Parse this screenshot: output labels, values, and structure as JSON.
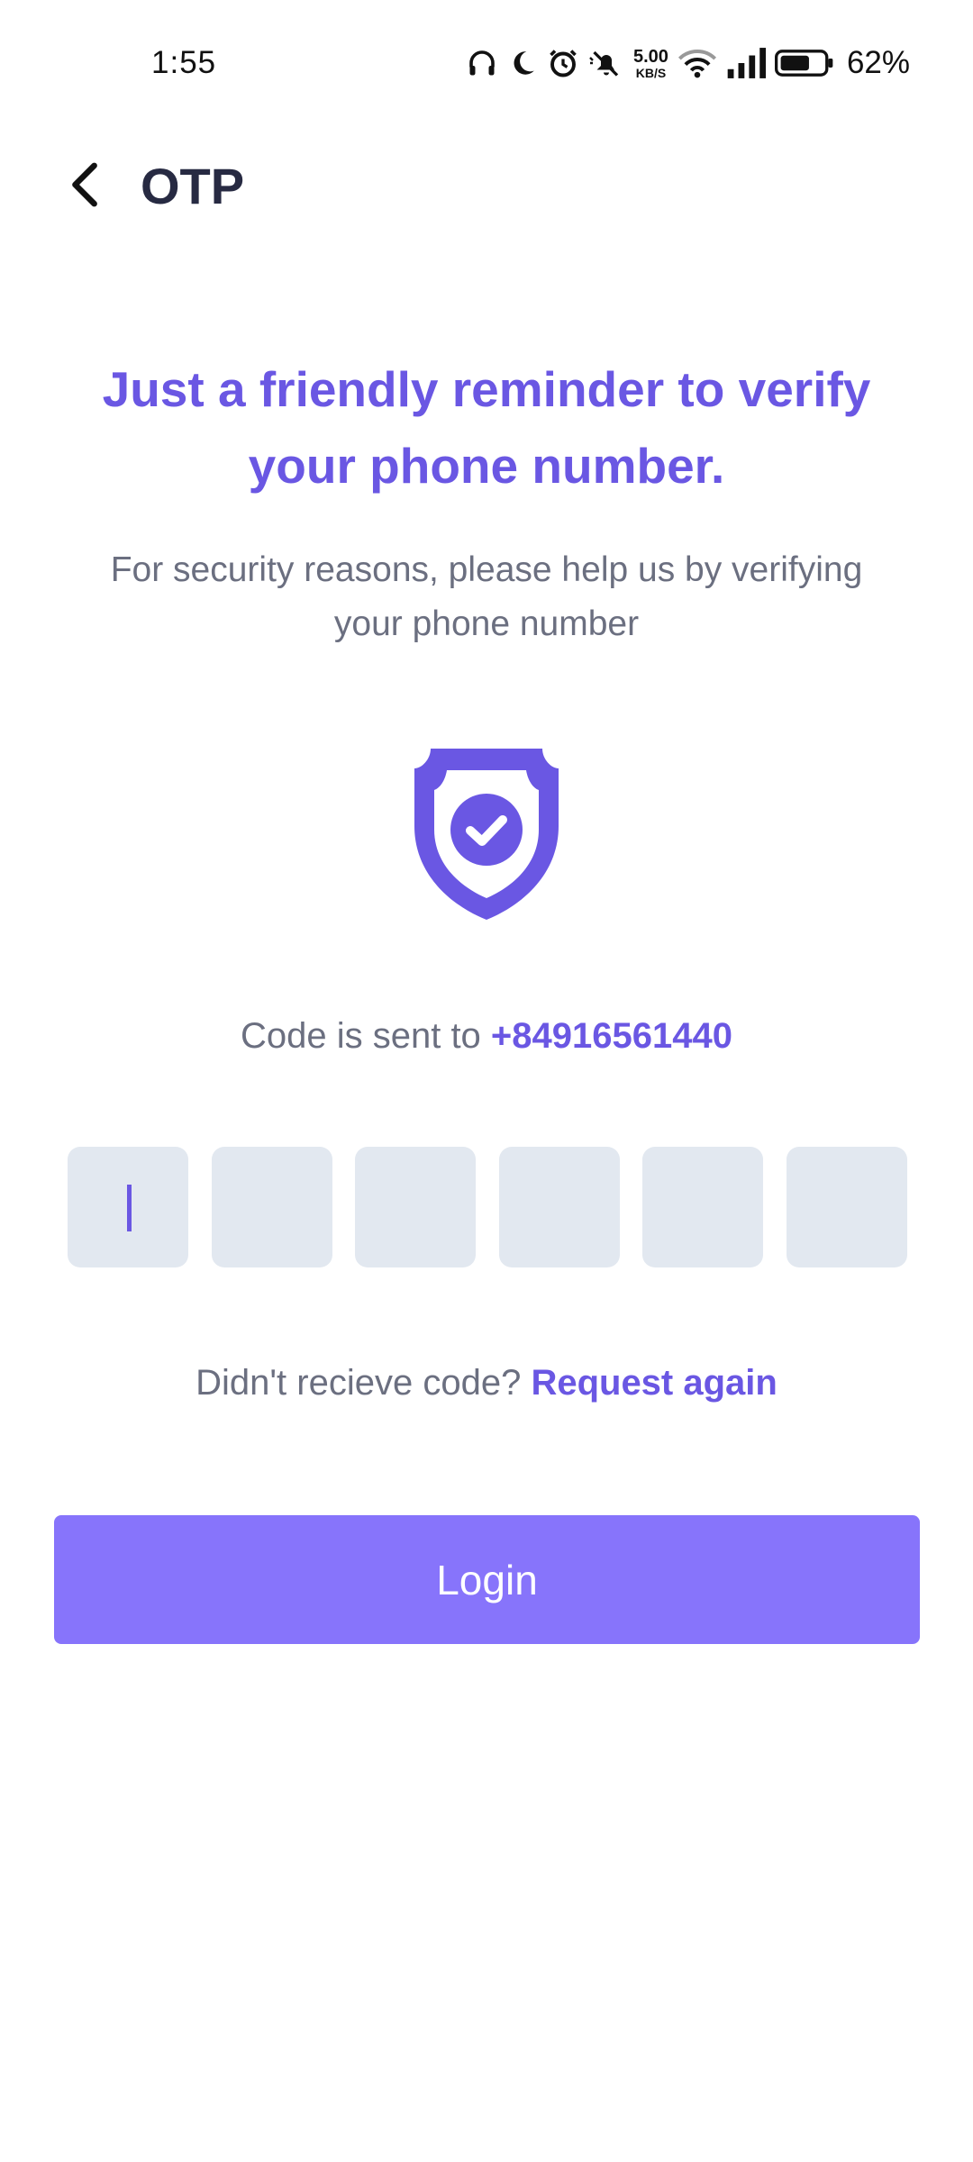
{
  "status_bar": {
    "time": "1:55",
    "net_speed_value": "5.00",
    "net_speed_unit": "KB/S",
    "battery_percent": "62%",
    "icons": [
      "headphones-icon",
      "moon-icon",
      "alarm-icon",
      "mute-icon",
      "wifi-icon",
      "signal-icon",
      "battery-icon"
    ]
  },
  "header": {
    "title": "OTP",
    "back_icon": "chevron-left-icon"
  },
  "main": {
    "headline": "Just a friendly reminder to verify your phone number.",
    "subtext": "For security reasons, please help us by verifying your phone number",
    "shield_icon": "shield-check-icon",
    "code_sent_prefix": "Code is sent to ",
    "phone_number": "+84916561440",
    "otp": {
      "digits": [
        "",
        "",
        "",
        "",
        "",
        ""
      ],
      "active_index": 0
    },
    "resend_prefix": "Didn't recieve code? ",
    "resend_link": "Request again",
    "login_label": "Login"
  },
  "colors": {
    "accent": "#6a57e3",
    "button": "#8774fb",
    "otp_box": "#e2e8f0",
    "muted_text": "#6b6f80"
  }
}
